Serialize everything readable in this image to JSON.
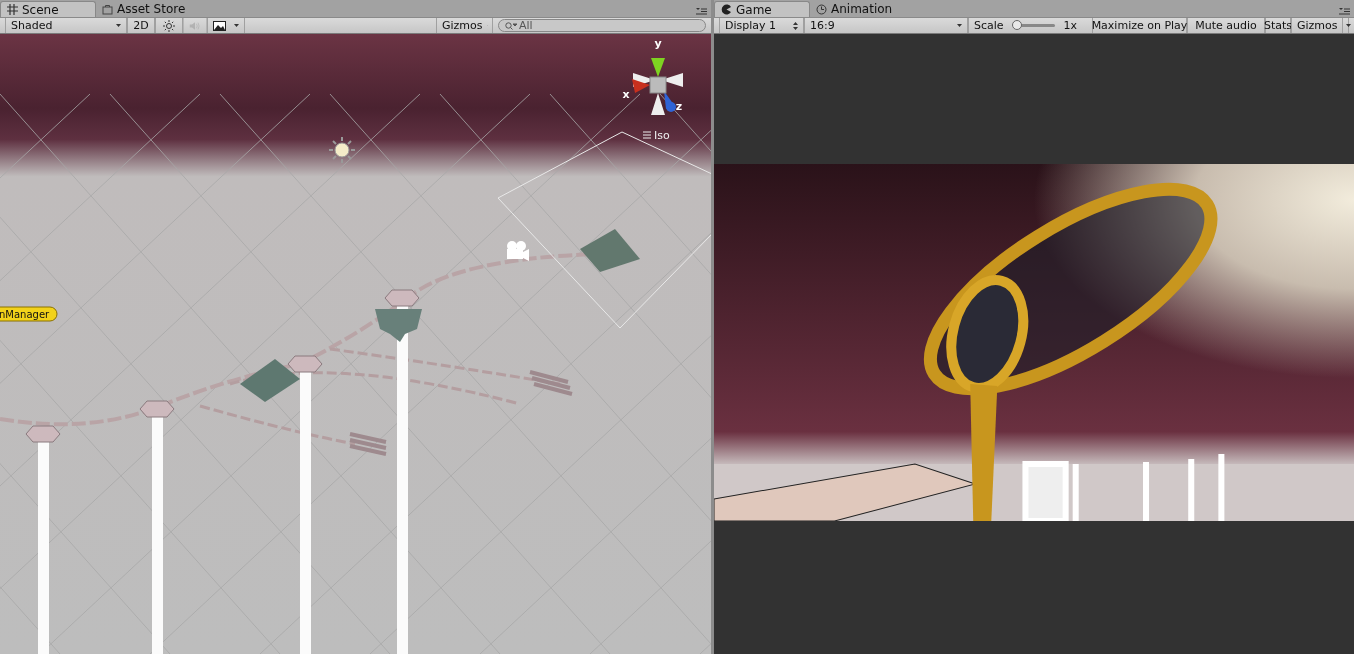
{
  "scene_panel": {
    "tabs": [
      {
        "label": "Scene",
        "selected": true
      },
      {
        "label": "Asset Store",
        "selected": false
      }
    ],
    "toolbar": [
      {
        "kind": "dropdown",
        "label": "Shaded"
      },
      {
        "kind": "button",
        "label": "2D",
        "on": false
      },
      {
        "kind": "lighting-toggle",
        "disabled": false
      },
      {
        "kind": "audio-toggle",
        "disabled": true
      },
      {
        "kind": "effects-dropdown"
      },
      {
        "kind": "spacer"
      },
      {
        "kind": "dropdown",
        "label": "Gizmos"
      },
      {
        "kind": "search",
        "placeholder": "All"
      }
    ],
    "viewport": {
      "gizmo": {
        "x_label": "x",
        "y_label": "y",
        "z_label": "z",
        "projection": "Iso"
      },
      "object_label": "nManager"
    }
  },
  "game_panel": {
    "tabs": [
      {
        "label": "Game",
        "selected": true
      },
      {
        "label": "Animation",
        "selected": false
      }
    ],
    "toolbar": [
      {
        "kind": "stepper",
        "label": "Display 1"
      },
      {
        "kind": "dropdown",
        "label": "16:9"
      },
      {
        "kind": "slider",
        "label": "Scale",
        "level": 0,
        "reading": "1x"
      },
      {
        "kind": "button",
        "label": "Maximize on Play",
        "on": false
      },
      {
        "kind": "button",
        "label": "Mute audio",
        "on": false
      },
      {
        "kind": "button",
        "label": "Stats",
        "on": false
      },
      {
        "kind": "split-dropdown",
        "label": "Gizmos"
      }
    ]
  }
}
